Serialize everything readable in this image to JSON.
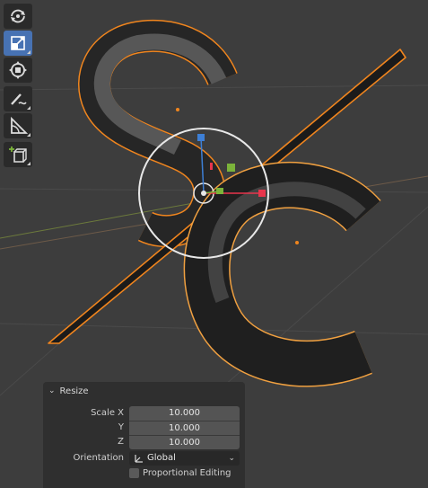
{
  "toolbar": {
    "tools": [
      {
        "name": "rotate-tool",
        "icon": "rotate-icon",
        "active": false
      },
      {
        "name": "scale-tool",
        "icon": "scale-icon",
        "active": true
      },
      {
        "name": "transform-tool",
        "icon": "transform-icon",
        "active": false
      },
      {
        "name": "annotate-tool",
        "icon": "annotate-icon",
        "active": false
      },
      {
        "name": "measure-tool",
        "icon": "measure-icon",
        "active": false
      },
      {
        "name": "add-cube-tool",
        "icon": "add-cube-icon",
        "active": false
      }
    ]
  },
  "panel": {
    "title": "Resize",
    "scale_x_label": "Scale X",
    "scale_y_label": "Y",
    "scale_z_label": "Z",
    "scale_x": "10.000",
    "scale_y": "10.000",
    "scale_z": "10.000",
    "orientation_label": "Orientation",
    "orientation_value": "Global",
    "proportional_label": "Proportional Editing",
    "proportional_checked": false
  },
  "colors": {
    "viewport_bg": "#3d3d3d",
    "selection_outline": "#f0851e",
    "active_tool": "#4772b3",
    "axis_x": "#e8354c",
    "axis_y": "#7bb33a",
    "axis_z": "#3d7fd6"
  }
}
